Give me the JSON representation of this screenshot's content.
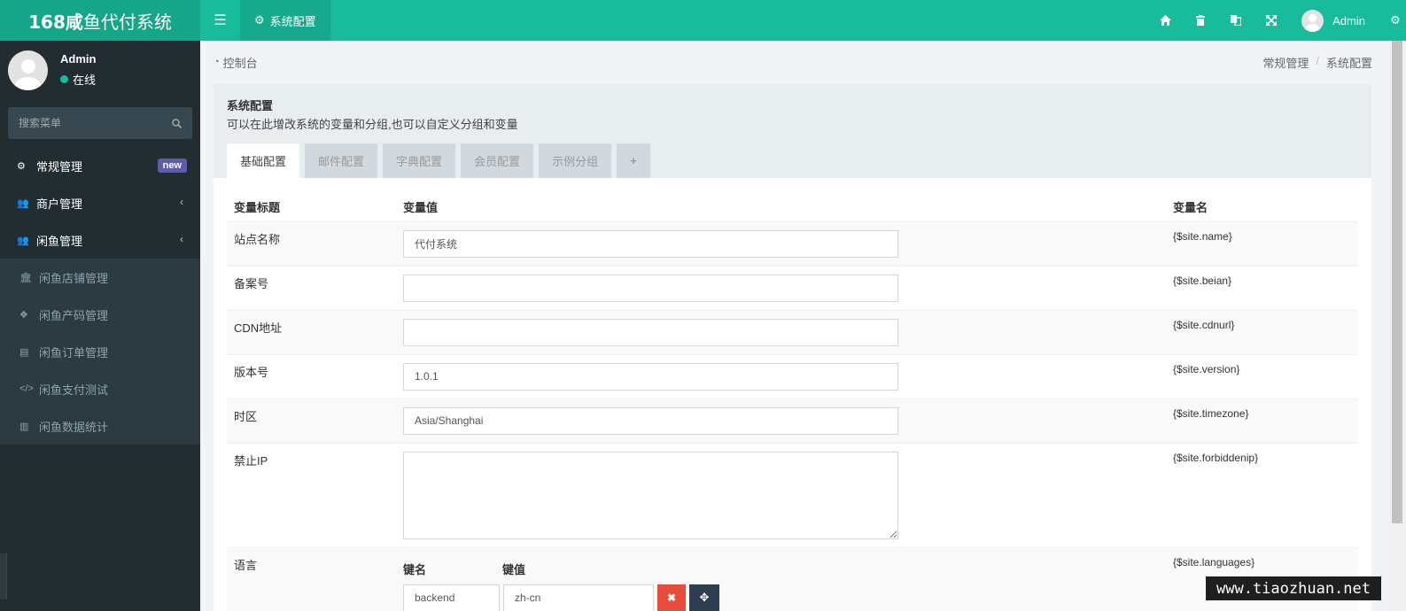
{
  "header": {
    "logo_bold": "168咸",
    "logo_rest": "鱼代付系统",
    "active_tab": "系统配置",
    "user_name": "Admin"
  },
  "sidebar": {
    "user_name": "Admin",
    "status": "在线",
    "search_placeholder": "搜索菜单",
    "items": [
      {
        "label": "常规管理",
        "badge": "new"
      },
      {
        "label": "商户管理"
      },
      {
        "label": "闲鱼管理"
      }
    ],
    "subitems": [
      {
        "label": "闲鱼店铺管理"
      },
      {
        "label": "闲鱼产码管理"
      },
      {
        "label": "闲鱼订单管理"
      },
      {
        "label": "闲鱼支付测试"
      },
      {
        "label": "闲鱼数据统计"
      }
    ]
  },
  "breadcrumb": {
    "home": "控制台",
    "parent": "常规管理",
    "current": "系统配置"
  },
  "panel": {
    "title": "系统配置",
    "description": "可以在此增改系统的变量和分组,也可以自定义分组和变量",
    "tabs": [
      "基础配置",
      "邮件配置",
      "字典配置",
      "会员配置",
      "示例分组"
    ],
    "plus": "+"
  },
  "table": {
    "headers": {
      "title": "变量标题",
      "value": "变量值",
      "name": "变量名"
    },
    "rows": [
      {
        "title": "站点名称",
        "value": "代付系统",
        "name": "{$site.name}"
      },
      {
        "title": "备案号",
        "value": "",
        "name": "{$site.beian}"
      },
      {
        "title": "CDN地址",
        "value": "",
        "name": "{$site.cdnurl}"
      },
      {
        "title": "版本号",
        "value": "1.0.1",
        "name": "{$site.version}"
      },
      {
        "title": "时区",
        "value": "Asia/Shanghai",
        "name": "{$site.timezone}"
      },
      {
        "title": "禁止IP",
        "value": "",
        "name": "{$site.forbiddenip}"
      }
    ],
    "language": {
      "title": "语言",
      "key_header": "键名",
      "value_header": "键值",
      "key": "backend",
      "value": "zh-cn",
      "name": "{$site.languages}"
    }
  },
  "watermark": "www.tiaozhuan.net",
  "colors": {
    "primary": "#18bc9c",
    "sidebar": "#222d32",
    "danger": "#e74c3c",
    "dark": "#2c3e50",
    "badge": "#605ca8"
  }
}
